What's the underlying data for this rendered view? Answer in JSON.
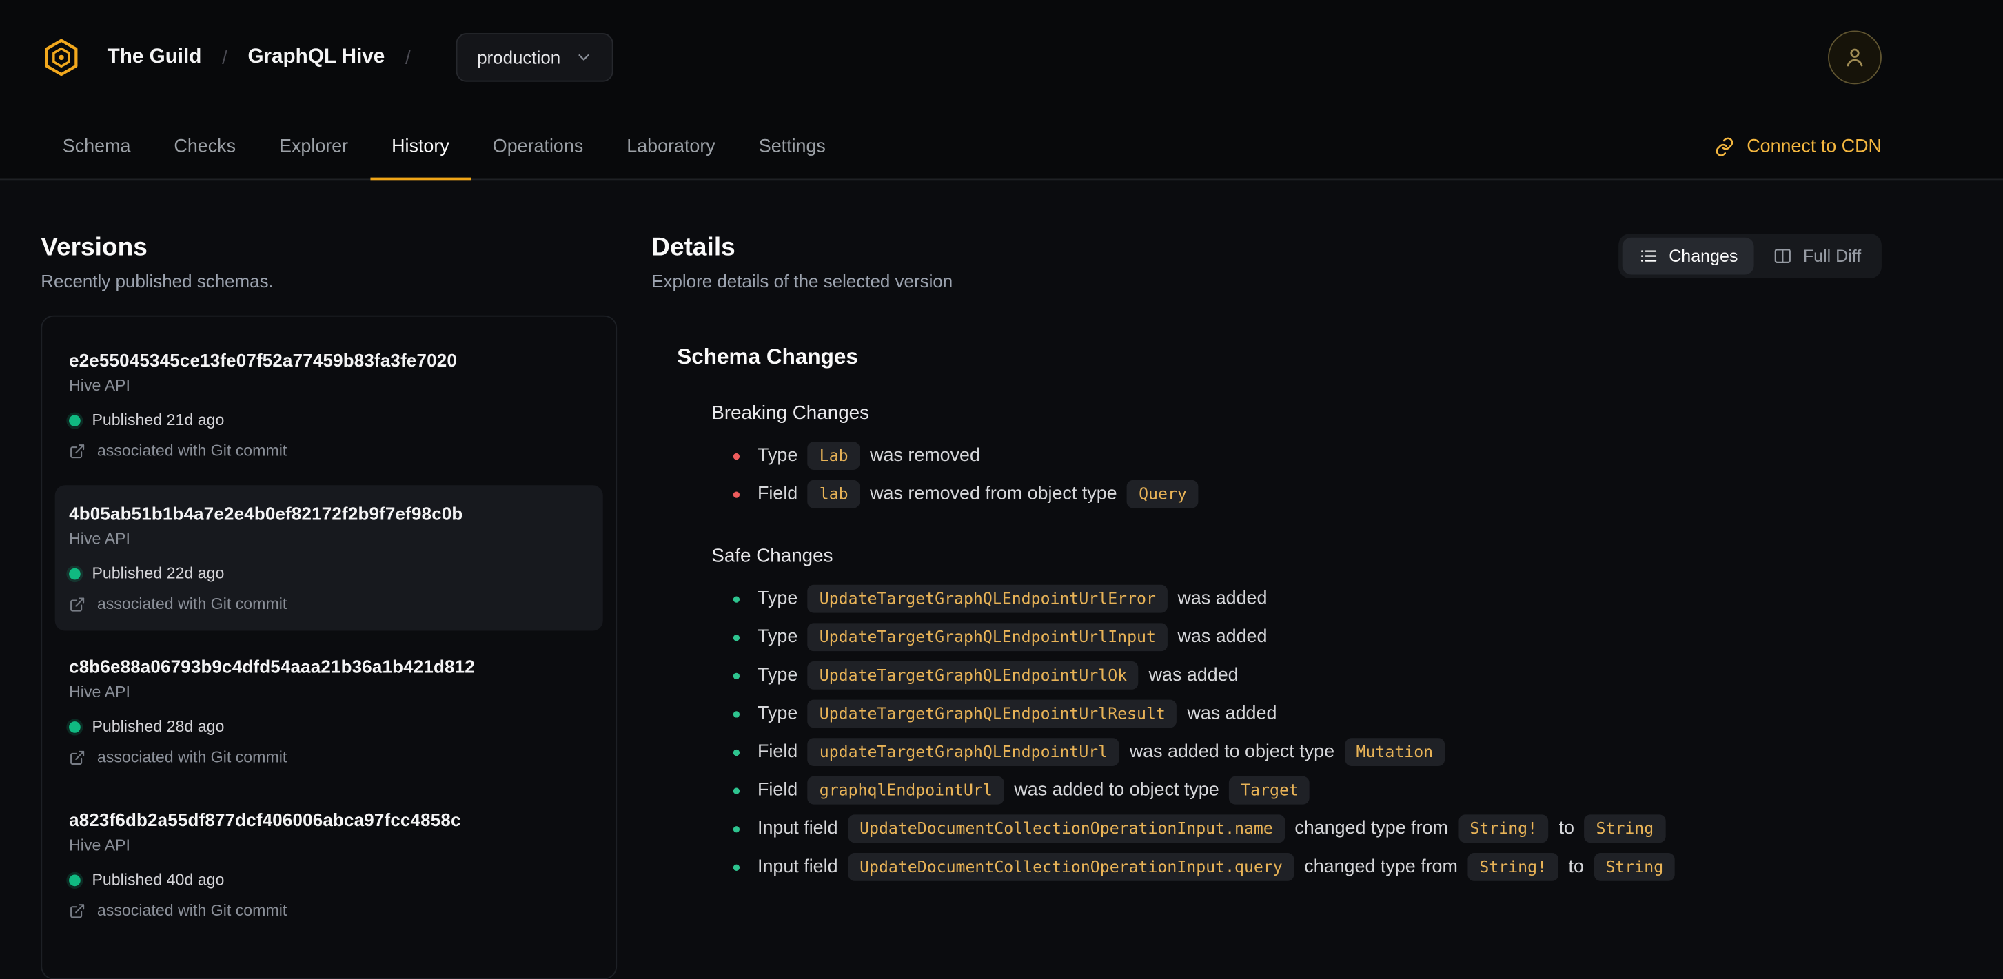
{
  "colors": {
    "accent": "#f4b740",
    "tab_underline": "#f0a618",
    "published_dot": "#10b981",
    "breaking_bullet": "#ee5c5c",
    "safe_bullet": "#2ec48f",
    "code_text": "#e8b357"
  },
  "header": {
    "logo_icon": "hive-logo-icon",
    "org": "The Guild",
    "separator": "/",
    "project": "GraphQL Hive",
    "target_selector": {
      "value": "production",
      "chevron_icon": "chevron-down-icon"
    },
    "avatar_icon": "user-avatar-icon",
    "tabs": [
      {
        "label": "Schema",
        "active": false
      },
      {
        "label": "Checks",
        "active": false
      },
      {
        "label": "Explorer",
        "active": false
      },
      {
        "label": "History",
        "active": true
      },
      {
        "label": "Operations",
        "active": false
      },
      {
        "label": "Laboratory",
        "active": false
      },
      {
        "label": "Settings",
        "active": false
      }
    ],
    "connect_cdn": {
      "label": "Connect to CDN",
      "icon": "link-icon"
    }
  },
  "versions": {
    "title": "Versions",
    "subtitle": "Recently published schemas.",
    "items": [
      {
        "hash": "e2e55045345ce13fe07f52a77459b83fa3fe7020",
        "service": "Hive API",
        "published": "Published 21d ago",
        "git": "associated with Git commit",
        "selected": false
      },
      {
        "hash": "4b05ab51b1b4a7e2e4b0ef82172f2b9f7ef98c0b",
        "service": "Hive API",
        "published": "Published 22d ago",
        "git": "associated with Git commit",
        "selected": true
      },
      {
        "hash": "c8b6e88a06793b9c4dfd54aaa21b36a1b421d812",
        "service": "Hive API",
        "published": "Published 28d ago",
        "git": "associated with Git commit",
        "selected": false
      },
      {
        "hash": "a823f6db2a55df877dcf406006abca97fcc4858c",
        "service": "Hive API",
        "published": "Published 40d ago",
        "git": "associated with Git commit",
        "selected": false
      }
    ]
  },
  "details": {
    "title": "Details",
    "subtitle": "Explore details of the selected version",
    "view_toggle": [
      {
        "label": "Changes",
        "icon": "list-icon",
        "active": true
      },
      {
        "label": "Full Diff",
        "icon": "diff-columns-icon",
        "active": false
      }
    ],
    "schema_changes_title": "Schema Changes",
    "groups": [
      {
        "title": "Breaking Changes",
        "kind": "breaking",
        "items": [
          {
            "segments": [
              {
                "t": "text",
                "v": "Type"
              },
              {
                "t": "code",
                "v": "Lab"
              },
              {
                "t": "text",
                "v": "was removed"
              }
            ]
          },
          {
            "segments": [
              {
                "t": "text",
                "v": "Field"
              },
              {
                "t": "code",
                "v": "lab"
              },
              {
                "t": "text",
                "v": "was removed from object type"
              },
              {
                "t": "code",
                "v": "Query"
              }
            ]
          }
        ]
      },
      {
        "title": "Safe Changes",
        "kind": "safe",
        "items": [
          {
            "segments": [
              {
                "t": "text",
                "v": "Type"
              },
              {
                "t": "code",
                "v": "UpdateTargetGraphQLEndpointUrlError"
              },
              {
                "t": "text",
                "v": "was added"
              }
            ]
          },
          {
            "segments": [
              {
                "t": "text",
                "v": "Type"
              },
              {
                "t": "code",
                "v": "UpdateTargetGraphQLEndpointUrlInput"
              },
              {
                "t": "text",
                "v": "was added"
              }
            ]
          },
          {
            "segments": [
              {
                "t": "text",
                "v": "Type"
              },
              {
                "t": "code",
                "v": "UpdateTargetGraphQLEndpointUrlOk"
              },
              {
                "t": "text",
                "v": "was added"
              }
            ]
          },
          {
            "segments": [
              {
                "t": "text",
                "v": "Type"
              },
              {
                "t": "code",
                "v": "UpdateTargetGraphQLEndpointUrlResult"
              },
              {
                "t": "text",
                "v": "was added"
              }
            ]
          },
          {
            "segments": [
              {
                "t": "text",
                "v": "Field"
              },
              {
                "t": "code",
                "v": "updateTargetGraphQLEndpointUrl"
              },
              {
                "t": "text",
                "v": "was added to object type"
              },
              {
                "t": "code",
                "v": "Mutation"
              }
            ]
          },
          {
            "segments": [
              {
                "t": "text",
                "v": "Field"
              },
              {
                "t": "code",
                "v": "graphqlEndpointUrl"
              },
              {
                "t": "text",
                "v": "was added to object type"
              },
              {
                "t": "code",
                "v": "Target"
              }
            ]
          },
          {
            "segments": [
              {
                "t": "text",
                "v": "Input field"
              },
              {
                "t": "code",
                "v": "UpdateDocumentCollectionOperationInput.name"
              },
              {
                "t": "text",
                "v": "changed type from"
              },
              {
                "t": "code",
                "v": "String!"
              },
              {
                "t": "text",
                "v": "to"
              },
              {
                "t": "code",
                "v": "String"
              }
            ]
          },
          {
            "segments": [
              {
                "t": "text",
                "v": "Input field"
              },
              {
                "t": "code",
                "v": "UpdateDocumentCollectionOperationInput.query"
              },
              {
                "t": "text",
                "v": "changed type from"
              },
              {
                "t": "code",
                "v": "String!"
              },
              {
                "t": "text",
                "v": "to"
              },
              {
                "t": "code",
                "v": "String"
              }
            ]
          }
        ]
      }
    ]
  }
}
